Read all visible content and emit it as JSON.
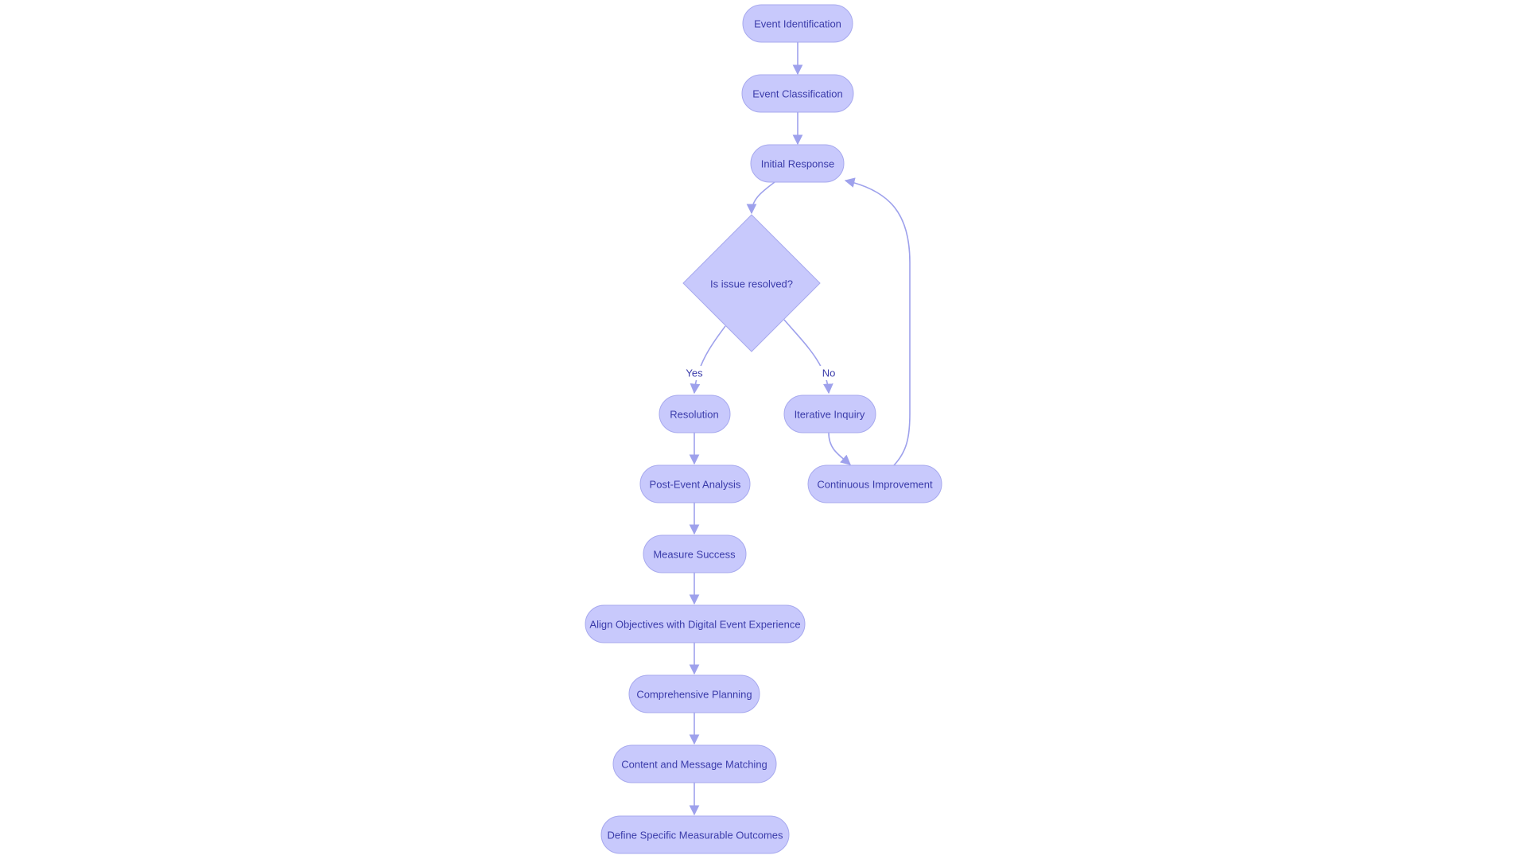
{
  "colors": {
    "node_fill": "#c8c9fc",
    "node_stroke": "#a7a9ee",
    "text": "#3b3caa",
    "edge": "#9ea1ec"
  },
  "nodes": {
    "event_identification": "Event Identification",
    "event_classification": "Event Classification",
    "initial_response": "Initial Response",
    "decision": "Is issue resolved?",
    "resolution": "Resolution",
    "iterative_inquiry": "Iterative Inquiry",
    "post_event_analysis": "Post-Event Analysis",
    "continuous_improvement": "Continuous Improvement",
    "measure_success": "Measure Success",
    "align_objectives": "Align Objectives with Digital Event Experience",
    "comprehensive_planning": "Comprehensive Planning",
    "content_matching": "Content and Message Matching",
    "define_outcomes": "Define Specific Measurable Outcomes"
  },
  "edge_labels": {
    "yes": "Yes",
    "no": "No"
  }
}
